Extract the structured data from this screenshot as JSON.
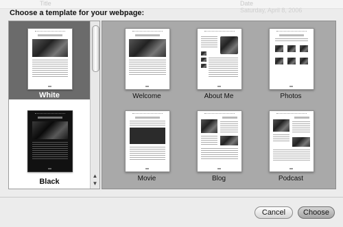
{
  "background": {
    "ghost_left": "Title",
    "ghost_right_label": "Date",
    "ghost_right": "Saturday, April 8, 2006"
  },
  "sheet": {
    "title": "Choose a template for your webpage:"
  },
  "themes": [
    {
      "label": "White",
      "selected": true,
      "style": "light"
    },
    {
      "label": "Black",
      "selected": false,
      "style": "dark"
    }
  ],
  "templates": [
    {
      "label": "Welcome"
    },
    {
      "label": "About Me"
    },
    {
      "label": "Photos"
    },
    {
      "label": "Movie"
    },
    {
      "label": "Blog"
    },
    {
      "label": "Podcast"
    }
  ],
  "buttons": {
    "cancel": "Cancel",
    "choose": "Choose"
  },
  "colors": {
    "selection": "#6b6b6b",
    "grid_background": "#a9a9a9"
  }
}
